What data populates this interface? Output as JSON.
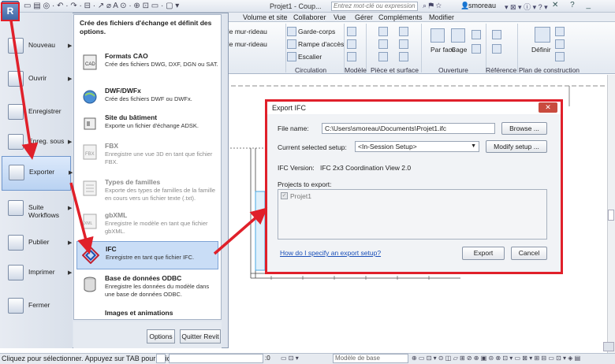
{
  "titlebar": {
    "app_button": "R",
    "document_title": "Projet1 - Coup...",
    "search_placeholder": "Entrez mot-clé ou expression",
    "user": "smoreau",
    "window_buttons": "✕ ? _"
  },
  "ribbon": {
    "tabs": [
      "Volume et site",
      "Collaborer",
      "Vue",
      "Gérer",
      "Compléments",
      "Modifier"
    ],
    "items": {
      "mur_rideau_1": "de mur-rideau",
      "mur_rideau_2": "de mur-rideau",
      "garde_corps": "Garde-corps",
      "rampe": "Rampe d'accès",
      "escalier": "Escalier",
      "par_face": "Par face",
      "cage": "Cage",
      "definir": "Définir"
    },
    "panels": [
      "Circulation",
      "Modèle",
      "Pièce et surface",
      "Ouverture",
      "Référence",
      "Plan de construction"
    ]
  },
  "appmenu": {
    "left_items": [
      {
        "label": "Nouveau",
        "arrow": "▶"
      },
      {
        "label": "Ouvrir",
        "arrow": "▶"
      },
      {
        "label": "Enregistrer",
        "arrow": ""
      },
      {
        "label": "Enreg. sous",
        "arrow": "▶"
      },
      {
        "label": "Exporter",
        "arrow": "▶"
      },
      {
        "label": "Suite Workflows",
        "arrow": "▶"
      },
      {
        "label": "Publier",
        "arrow": "▶"
      },
      {
        "label": "Imprimer",
        "arrow": "▶"
      },
      {
        "label": "Fermer",
        "arrow": ""
      }
    ],
    "panel_header": "Crée des fichiers d'échange et définit des options.",
    "panel_items": [
      {
        "title": "Formats CAO",
        "desc": "Crée des fichiers DWG, DXF, DGN ou SAT."
      },
      {
        "title": "DWF/DWFx",
        "desc": "Crée des fichiers DWF ou DWFx."
      },
      {
        "title": "Site du bâtiment",
        "desc": "Exporte un fichier d'échange ADSK."
      },
      {
        "title": "FBX",
        "desc": "Enregistre une vue 3D en tant que fichier FBX."
      },
      {
        "title": "Types de familles",
        "desc": "Exporte des types de familles de la famille en cours vers un fichier texte (.txt)."
      },
      {
        "title": "gbXML",
        "desc": "Enregistre le modèle en tant que fichier gbXML."
      },
      {
        "title": "IFC",
        "desc": "Enregistre en tant que fichier IFC."
      },
      {
        "title": "Base de données ODBC",
        "desc": "Enregistre les données du modèle dans une base de données ODBC."
      },
      {
        "title": "Images et animations",
        "desc": ""
      }
    ],
    "options_button": "Options",
    "quit_button": "Quitter Revit"
  },
  "dialog": {
    "title": "Export IFC",
    "close": "✕",
    "file_name_label": "File name:",
    "file_name_value": "C:\\Users\\smoreau\\Documents\\Projet1.ifc",
    "browse_button": "Browse ...",
    "setup_label": "Current selected setup:",
    "setup_value": "<In-Session Setup>",
    "modify_button": "Modify setup ...",
    "version_label": "IFC Version:",
    "version_value": "IFC 2x3 Coordination View 2.0",
    "projects_label": "Projects to export:",
    "project_item": "Projet1",
    "help_link": "How do I specify an export setup?",
    "export_button": "Export",
    "cancel_button": "Cancel"
  },
  "statusbar": {
    "text": "Cliquez pour sélectionner. Appuyez sur TAB pour affich",
    "coord": ":0",
    "model": "Modèle de base"
  },
  "colors": {
    "annotation_red": "#e0202a",
    "ribbon_bg": "#e3e9f1",
    "selection_blue": "#c9ddf6"
  }
}
